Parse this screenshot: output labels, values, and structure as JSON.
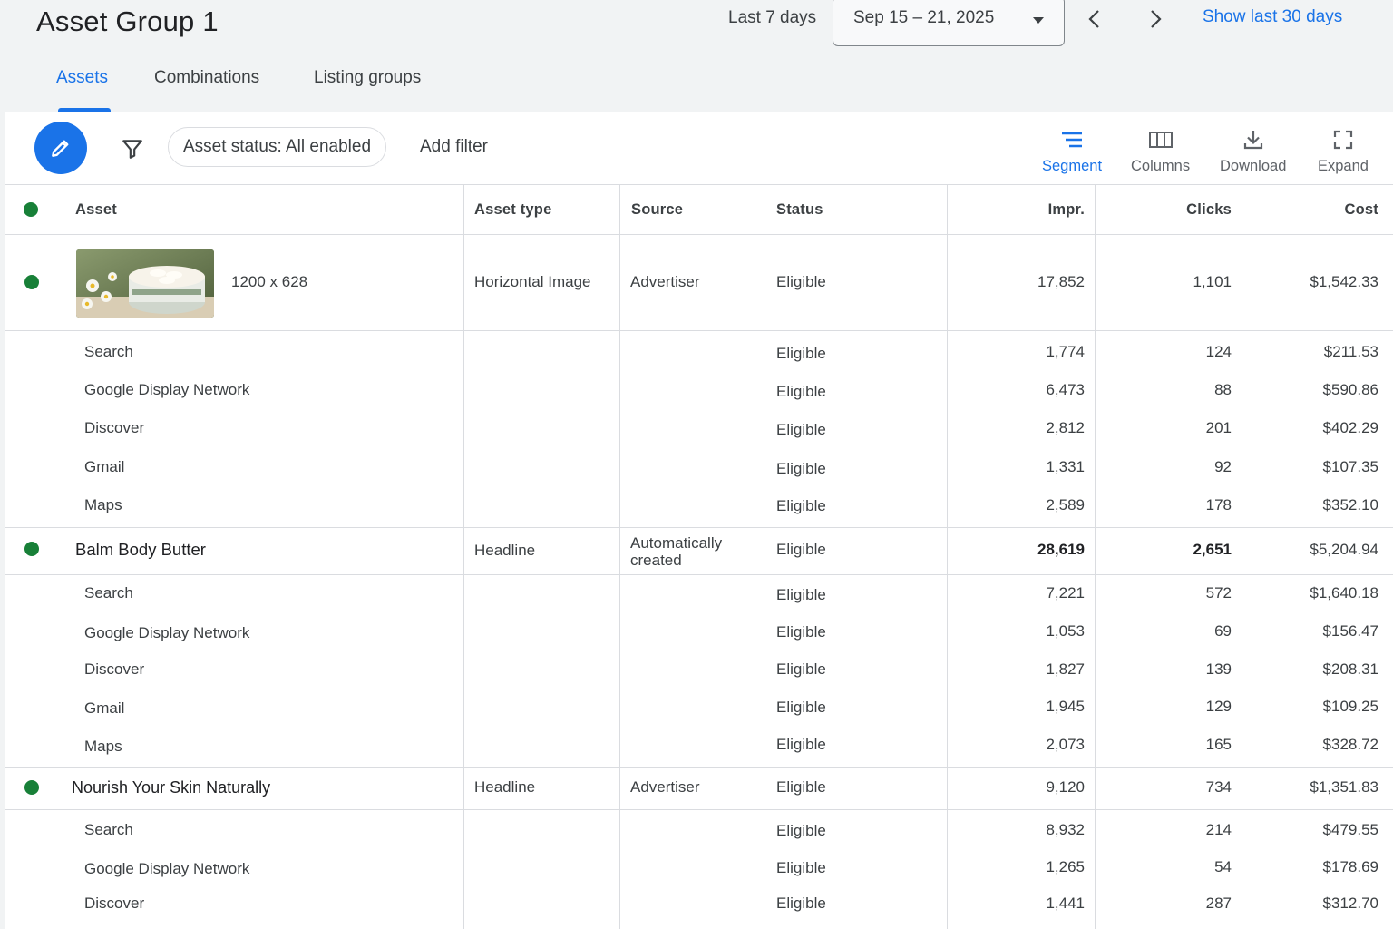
{
  "header": {
    "title": "Asset Group 1",
    "range_label": "Last 7 days",
    "date_range": "Sep 15 – 21, 2025",
    "show_last_label": "Show last 30 days"
  },
  "tabs": [
    {
      "label": "Assets",
      "active": true
    },
    {
      "label": "Combinations",
      "active": false
    },
    {
      "label": "Listing groups",
      "active": false
    }
  ],
  "toolbar": {
    "filter_chip": "Asset status: All enabled",
    "add_filter": "Add filter",
    "segment": "Segment",
    "columns": "Columns",
    "download": "Download",
    "expand": "Expand"
  },
  "table": {
    "headers": {
      "asset": "Asset",
      "asset_type": "Asset type",
      "source": "Source",
      "status": "Status",
      "impr": "Impr.",
      "clicks": "Clicks",
      "cost": "Cost"
    },
    "status_color": "#188038",
    "groups": [
      {
        "asset": "1200 x 628",
        "has_image": true,
        "asset_type": "Horizontal Image",
        "source": "Advertiser",
        "status": "Eligible",
        "impr": "17,852",
        "clicks": "1,101",
        "cost": "$1,542.33",
        "segments": [
          {
            "network": "Search",
            "status": "Eligible",
            "impr": "1,774",
            "clicks": "124",
            "cost": "$211.53"
          },
          {
            "network": "Google Display Network",
            "status": "Eligible",
            "impr": "6,473",
            "clicks": "88",
            "cost": "$590.86"
          },
          {
            "network": "Discover",
            "status": "Eligible",
            "impr": "2,812",
            "clicks": "201",
            "cost": "$402.29"
          },
          {
            "network": "Gmail",
            "status": "Eligible",
            "impr": "1,331",
            "clicks": "92",
            "cost": "$107.35"
          },
          {
            "network": "Maps",
            "status": "Eligible",
            "impr": "2,589",
            "clicks": "178",
            "cost": "$352.10"
          }
        ]
      },
      {
        "asset": "Balm Body Butter",
        "asset_type": "Headline",
        "source": "Automatically created",
        "status": "Eligible",
        "impr": "28,619",
        "clicks": "2,651",
        "cost": "$5,204.94",
        "segments": [
          {
            "network": "Search",
            "status": "Eligible",
            "impr": "7,221",
            "clicks": "572",
            "cost": "$1,640.18"
          },
          {
            "network": "Google Display Network",
            "status": "Eligible",
            "impr": "1,053",
            "clicks": "69",
            "cost": "$156.47"
          },
          {
            "network": "Discover",
            "status": "Eligible",
            "impr": "1,827",
            "clicks": "139",
            "cost": "$208.31"
          },
          {
            "network": "Gmail",
            "status": "Eligible",
            "impr": "1,945",
            "clicks": "129",
            "cost": "$109.25"
          },
          {
            "network": "Maps",
            "status": "Eligible",
            "impr": "2,073",
            "clicks": "165",
            "cost": "$328.72"
          }
        ]
      },
      {
        "asset": "Nourish Your Skin Naturally",
        "asset_type": "Headline",
        "source": "Advertiser",
        "status": "Eligible",
        "impr": "9,120",
        "clicks": "734",
        "cost": "$1,351.83",
        "segments": [
          {
            "network": "Search",
            "status": "Eligible",
            "impr": "8,932",
            "clicks": "214",
            "cost": "$479.55"
          },
          {
            "network": "Google Display Network",
            "status": "Eligible",
            "impr": "1,265",
            "clicks": "54",
            "cost": "$178.69"
          },
          {
            "network": "Discover",
            "status": "Eligible",
            "impr": "1,441",
            "clicks": "287",
            "cost": "$312.70"
          }
        ]
      }
    ]
  },
  "icons": {
    "edit": "pencil-icon",
    "filter": "funnel-icon",
    "segment": "segment-lines-icon",
    "columns": "columns-icon",
    "download": "download-icon",
    "expand": "fullscreen-icon",
    "prev": "chevron-left-icon",
    "next": "chevron-right-icon",
    "dropdown": "caret-down-icon"
  }
}
